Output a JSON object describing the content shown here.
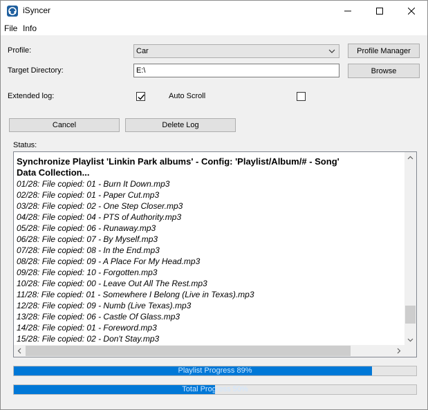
{
  "window": {
    "title": "iSyncer",
    "minimize_icon": "minimize-icon",
    "maximize_icon": "maximize-icon",
    "close_icon": "close-icon"
  },
  "menu": {
    "items": [
      "File",
      "Info"
    ]
  },
  "form": {
    "profile_label": "Profile:",
    "profile_value": "Car",
    "profile_manager_button": "Profile Manager",
    "target_dir_label": "Target Directory:",
    "target_dir_value": "E:\\",
    "browse_button": "Browse",
    "extended_log_label": "Extended log:",
    "extended_log_checked": true,
    "auto_scroll_label": "Auto Scroll",
    "auto_scroll_checked": false
  },
  "actions": {
    "cancel_button": "Cancel",
    "delete_log_button": "Delete Log"
  },
  "status": {
    "label": "Status:",
    "heading": "Synchronize Playlist 'Linkin Park albums' - Config: 'Playlist/Album/# - Song'",
    "subheading": "Data Collection...",
    "lines": [
      "01/28: File copied: 01 - Burn It Down.mp3",
      "02/28: File copied: 01 - Paper Cut.mp3",
      "03/28: File copied: 02 - One Step Closer.mp3",
      "04/28: File copied: 04 - PTS of Authority.mp3",
      "05/28: File copied: 06 - Runaway.mp3",
      "06/28: File copied: 07 - By Myself.mp3",
      "07/28: File copied: 08 - In the End.mp3",
      "08/28: File copied: 09 - A Place For My Head.mp3",
      "09/28: File copied: 10 - Forgotten.mp3",
      "10/28: File copied: 00 - Leave Out All The Rest.mp3",
      "11/28: File copied: 01 - Somewhere I Belong (Live in Texas).mp3",
      "12/28: File copied: 09 - Numb (Live Texas).mp3",
      "13/28: File copied: 06 - Castle Of Glass.mp3",
      "14/28: File copied: 01 - Foreword.mp3",
      "15/28: File copied: 02 - Don't Stay.mp3"
    ]
  },
  "progress": {
    "playlist_label": "Playlist Progress 89%",
    "playlist_value": 0.89,
    "total_label": "Total Progress 50%",
    "total_value": 0.5
  },
  "colors": {
    "progress_fill": "#0078d7",
    "window_bg": "#f0f0f0"
  }
}
